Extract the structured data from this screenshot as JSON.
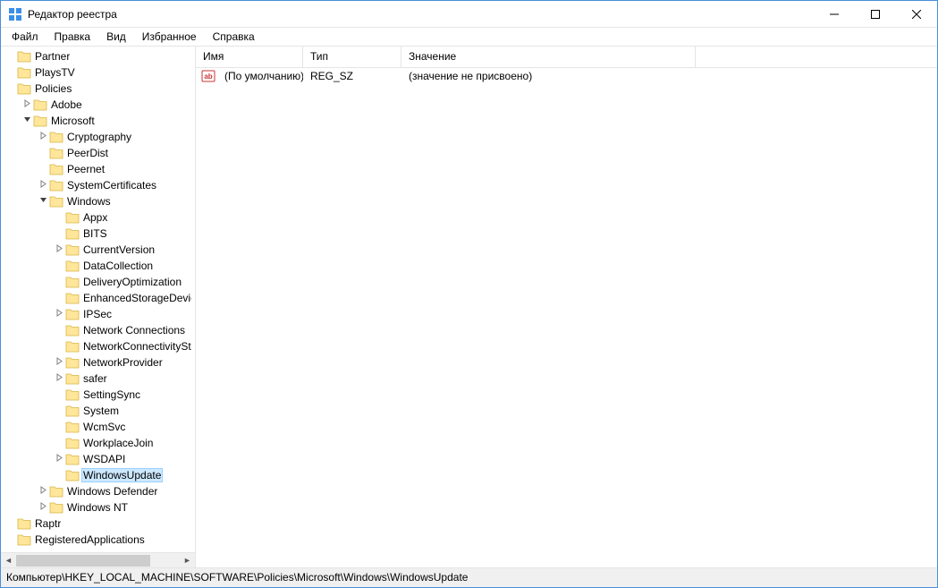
{
  "window": {
    "title": "Редактор реестра"
  },
  "menu": {
    "file": "Файл",
    "edit": "Правка",
    "view": "Вид",
    "favorites": "Избранное",
    "help": "Справка"
  },
  "tree": [
    {
      "depth": 0,
      "expander": "",
      "label": "Partner"
    },
    {
      "depth": 0,
      "expander": "",
      "label": "PlaysTV"
    },
    {
      "depth": 0,
      "expander": "",
      "label": "Policies"
    },
    {
      "depth": 1,
      "expander": ">",
      "label": "Adobe"
    },
    {
      "depth": 1,
      "expander": "v",
      "label": "Microsoft"
    },
    {
      "depth": 2,
      "expander": ">",
      "label": "Cryptography"
    },
    {
      "depth": 2,
      "expander": "",
      "label": "PeerDist"
    },
    {
      "depth": 2,
      "expander": "",
      "label": "Peernet"
    },
    {
      "depth": 2,
      "expander": ">",
      "label": "SystemCertificates"
    },
    {
      "depth": 2,
      "expander": "v",
      "label": "Windows"
    },
    {
      "depth": 3,
      "expander": "",
      "label": "Appx"
    },
    {
      "depth": 3,
      "expander": "",
      "label": "BITS"
    },
    {
      "depth": 3,
      "expander": ">",
      "label": "CurrentVersion"
    },
    {
      "depth": 3,
      "expander": "",
      "label": "DataCollection"
    },
    {
      "depth": 3,
      "expander": "",
      "label": "DeliveryOptimization"
    },
    {
      "depth": 3,
      "expander": "",
      "label": "EnhancedStorageDevices"
    },
    {
      "depth": 3,
      "expander": ">",
      "label": "IPSec"
    },
    {
      "depth": 3,
      "expander": "",
      "label": "Network Connections"
    },
    {
      "depth": 3,
      "expander": "",
      "label": "NetworkConnectivityStatusIndicator"
    },
    {
      "depth": 3,
      "expander": ">",
      "label": "NetworkProvider"
    },
    {
      "depth": 3,
      "expander": ">",
      "label": "safer"
    },
    {
      "depth": 3,
      "expander": "",
      "label": "SettingSync"
    },
    {
      "depth": 3,
      "expander": "",
      "label": "System"
    },
    {
      "depth": 3,
      "expander": "",
      "label": "WcmSvc"
    },
    {
      "depth": 3,
      "expander": "",
      "label": "WorkplaceJoin"
    },
    {
      "depth": 3,
      "expander": ">",
      "label": "WSDAPI"
    },
    {
      "depth": 3,
      "expander": "",
      "label": "WindowsUpdate",
      "selected": true
    },
    {
      "depth": 2,
      "expander": ">",
      "label": "Windows Defender"
    },
    {
      "depth": 2,
      "expander": ">",
      "label": "Windows NT"
    },
    {
      "depth": 0,
      "expander": "",
      "label": "Raptr"
    },
    {
      "depth": 0,
      "expander": "",
      "label": "RegisteredApplications"
    }
  ],
  "list": {
    "columns": {
      "name": "Имя",
      "type": "Тип",
      "value": "Значение"
    },
    "rows": [
      {
        "name": "(По умолчанию)",
        "type": "REG_SZ",
        "value": "(значение не присвоено)"
      }
    ]
  },
  "statusbar": "Компьютер\\HKEY_LOCAL_MACHINE\\SOFTWARE\\Policies\\Microsoft\\Windows\\WindowsUpdate"
}
